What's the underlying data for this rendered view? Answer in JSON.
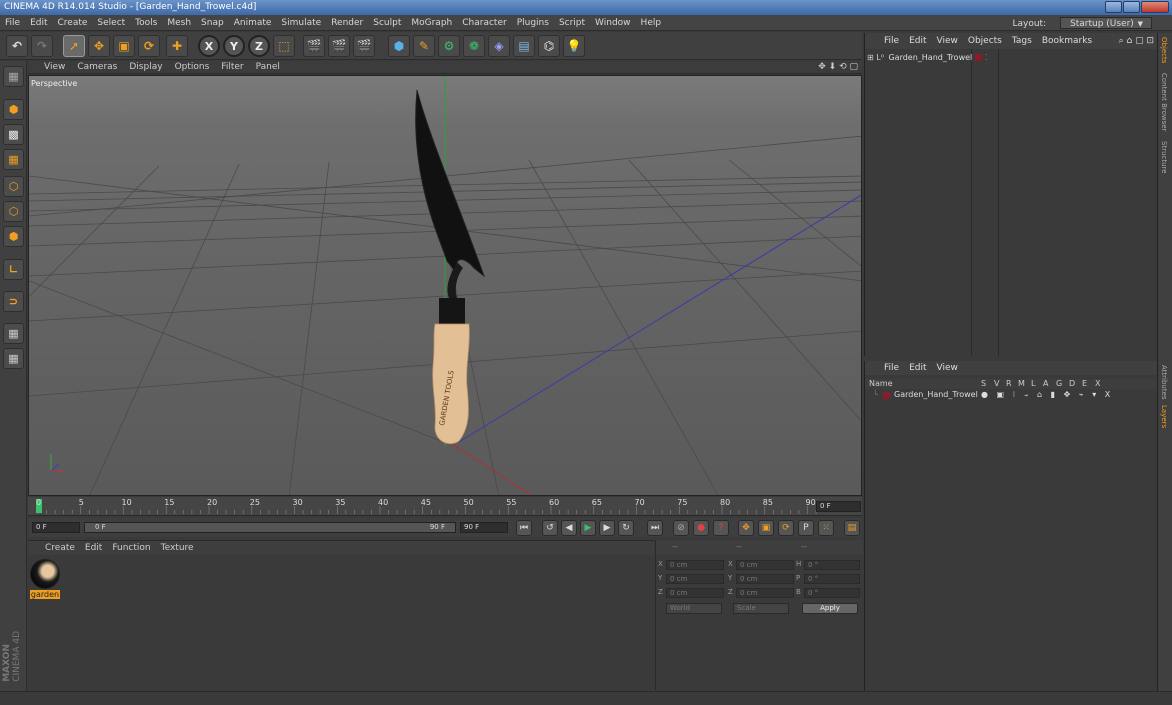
{
  "window": {
    "title": "CINEMA 4D R14.014 Studio - [Garden_Hand_Trowel.c4d]"
  },
  "menubar": {
    "items": [
      "File",
      "Edit",
      "Create",
      "Select",
      "Tools",
      "Mesh",
      "Snap",
      "Animate",
      "Simulate",
      "Render",
      "Sculpt",
      "MoGraph",
      "Character",
      "Plugins",
      "Script",
      "Window",
      "Help"
    ],
    "layout_label": "Layout:",
    "layout_value": "Startup (User)"
  },
  "toolbar": {
    "undo": "undo-icon",
    "redo": "redo-icon",
    "x": "X",
    "y": "Y",
    "z": "Z"
  },
  "viewport": {
    "menu": [
      "View",
      "Cameras",
      "Display",
      "Options",
      "Filter",
      "Panel"
    ],
    "label": "Perspective",
    "handle_text": "GARDEN TOOLS"
  },
  "timeline": {
    "ticks": [
      "0",
      "5",
      "10",
      "15",
      "20",
      "25",
      "30",
      "35",
      "40",
      "45",
      "50",
      "55",
      "60",
      "65",
      "70",
      "75",
      "80",
      "85",
      "90"
    ],
    "current": "0 F"
  },
  "transport": {
    "start": "0 F",
    "slider_left": "0 F",
    "slider_right": "90 F",
    "end": "90 F"
  },
  "material_manager": {
    "menu": [
      "Create",
      "Edit",
      "Function",
      "Texture"
    ],
    "materials": [
      {
        "name": "garden"
      }
    ]
  },
  "attributes": {
    "header": [
      "--",
      "--",
      "--"
    ],
    "rows": [
      {
        "a": "X",
        "av": "0 cm",
        "b": "X",
        "bv": "0 cm",
        "c": "H",
        "cv": "0 °"
      },
      {
        "a": "Y",
        "av": "0 cm",
        "b": "Y",
        "bv": "0 cm",
        "c": "P",
        "cv": "0 °"
      },
      {
        "a": "Z",
        "av": "0 cm",
        "b": "Z",
        "bv": "0 cm",
        "c": "B",
        "cv": "0 °"
      }
    ],
    "world": "World",
    "scale": "Scale",
    "apply": "Apply"
  },
  "object_manager": {
    "menu": [
      "File",
      "Edit",
      "View",
      "Objects",
      "Tags",
      "Bookmarks"
    ],
    "objects": [
      {
        "name": "Garden_Hand_Trowel",
        "color": "#8b1a2a"
      }
    ]
  },
  "layer_manager": {
    "menu": [
      "File",
      "Edit",
      "View"
    ],
    "columns": [
      "Name",
      "S",
      "V",
      "R",
      "M",
      "L",
      "A",
      "G",
      "D",
      "E",
      "X"
    ],
    "layers": [
      {
        "name": "Garden_Hand_Trowel",
        "color": "#8b1a2a"
      }
    ]
  },
  "right_tabs": [
    "Objects",
    "Content Browser",
    "Structure",
    "Attributes",
    "Layers"
  ],
  "brand": {
    "logo_top": "MAXON",
    "logo_bottom": "CINEMA 4D"
  }
}
